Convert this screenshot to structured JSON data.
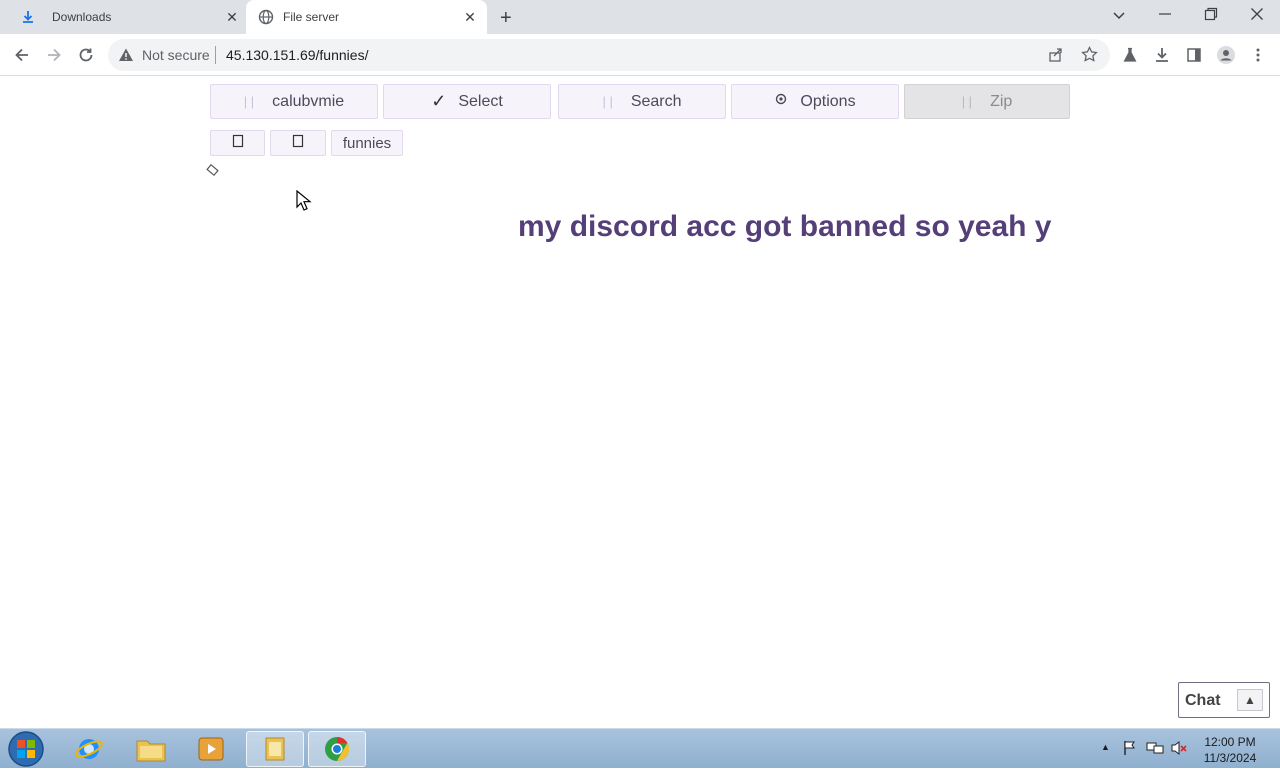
{
  "browser": {
    "tabs": [
      {
        "label": "Downloads",
        "icon": "download-icon",
        "active": false
      },
      {
        "label": "File server",
        "icon": "globe-icon",
        "active": true
      }
    ],
    "security_label": "Not secure",
    "url": "45.130.151.69/funnies/"
  },
  "page": {
    "buttons": {
      "user": "calubvmie",
      "select": "Select",
      "search": "Search",
      "options": "Options",
      "zip": "Zip"
    },
    "breadcrumb": {
      "current": "funnies"
    },
    "banner_text": "my discord acc got banned so yeah y",
    "chat": {
      "label": "Chat",
      "toggle": "▲"
    }
  },
  "taskbar": {
    "time": "12:00 PM",
    "date": "11/3/2024"
  },
  "colors": {
    "accent": "#553f78",
    "button_bg": "#f7f3fb",
    "taskbar": "#9ab7d4"
  }
}
